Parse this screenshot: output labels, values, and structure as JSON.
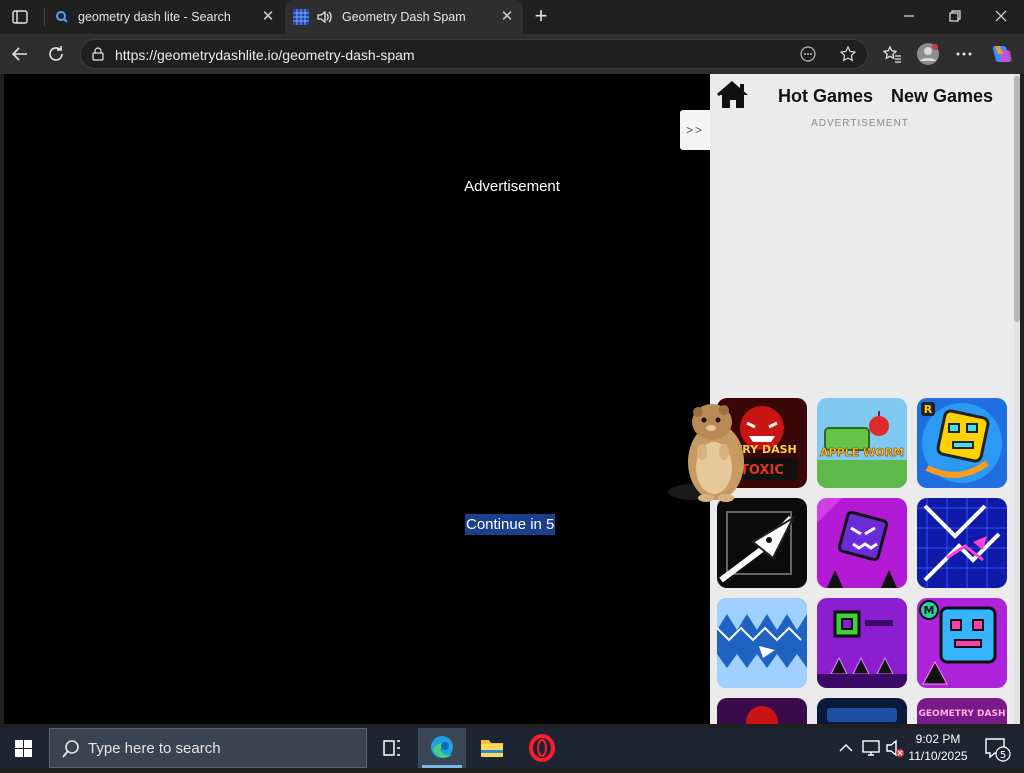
{
  "browser": {
    "tabs": [
      {
        "title": "geometry dash lite - Search",
        "favicon": "search-icon",
        "active": false
      },
      {
        "title": "Geometry Dash Spam",
        "favicon": "grid-favicon-icon",
        "active": true,
        "audio": "speaker-icon"
      }
    ],
    "address": "https://geometrydashlite.io/geometry-dash-spam"
  },
  "page": {
    "ad_label": "Advertisement",
    "continue_label": "Continue in 5",
    "sidebar": {
      "collapse_label": ">>",
      "nav": {
        "hot": "Hot Games",
        "new": "New Games"
      },
      "advertisement_small": "ADVERTISEMENT",
      "thumbnails": [
        {
          "name": "geometry-dash-toxic-thumbnail",
          "text": "ETRY DASH"
        },
        {
          "name": "apple-worm-thumbnail",
          "text": "APPLE WORM"
        },
        {
          "name": "geometry-dash-r-thumbnail",
          "badge": "R"
        },
        {
          "name": "wave-arrow-thumbnail"
        },
        {
          "name": "angry-cube-thumbnail"
        },
        {
          "name": "neon-wave-thumbnail"
        },
        {
          "name": "spike-wave-thumbnail"
        },
        {
          "name": "purple-cube-spikes-thumbnail"
        },
        {
          "name": "geometry-dash-m-thumbnail",
          "badge": "M"
        },
        {
          "name": "partial-thumbnail-1"
        },
        {
          "name": "partial-thumbnail-2"
        },
        {
          "name": "partial-thumbnail-3",
          "text": "GEOMETRY DASH"
        }
      ]
    }
  },
  "taskbar": {
    "search_placeholder": "Type here to search",
    "time": "9:02 PM",
    "date": "11/10/2025",
    "notification_count": "5"
  }
}
